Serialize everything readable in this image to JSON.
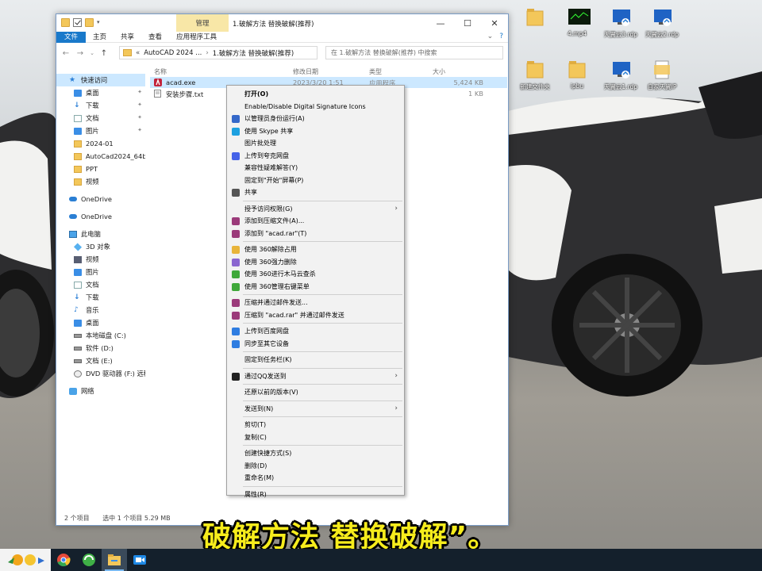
{
  "window": {
    "title": "1.破解方法 替换破解(推荐)",
    "manage_tab": "管理",
    "controls": [
      "—",
      "☐",
      "✕"
    ]
  },
  "ribbon": {
    "tabs": [
      "文件",
      "主页",
      "共享",
      "查看",
      "应用程序工具"
    ]
  },
  "address": {
    "path_root": "AutoCAD 2024 ...",
    "path_sep": "›",
    "path_leaf": "1.破解方法 替换破解(推荐)",
    "search_placeholder": "在 1.破解方法 替换破解(推荐) 中搜索"
  },
  "sidebar": {
    "items": [
      {
        "label": "快速访问",
        "icon": "star-icon",
        "pin": false,
        "sel": true,
        "indent": 0,
        "kind": "star"
      },
      {
        "label": "桌面",
        "icon": "desktop-icon",
        "pin": true,
        "indent": 1,
        "kind": "blue"
      },
      {
        "label": "下载",
        "icon": "download-icon",
        "pin": true,
        "indent": 1,
        "kind": "dl"
      },
      {
        "label": "文档",
        "icon": "document-icon",
        "pin": true,
        "indent": 1,
        "kind": "doc"
      },
      {
        "label": "图片",
        "icon": "picture-icon",
        "pin": true,
        "indent": 1,
        "kind": "blue"
      },
      {
        "label": "2024-01",
        "icon": "folder-icon",
        "pin": false,
        "indent": 1,
        "kind": "folder"
      },
      {
        "label": "AutoCad2024_64bi",
        "icon": "folder-icon",
        "pin": false,
        "indent": 1,
        "kind": "folder"
      },
      {
        "label": "PPT",
        "icon": "folder-icon",
        "pin": false,
        "indent": 1,
        "kind": "folder"
      },
      {
        "label": "视频",
        "icon": "folder-icon",
        "pin": false,
        "indent": 1,
        "kind": "folder"
      },
      {
        "label": "",
        "spacer": true
      },
      {
        "label": "OneDrive",
        "icon": "cloud-icon",
        "indent": 0,
        "kind": "cloud"
      },
      {
        "label": "",
        "spacer": true
      },
      {
        "label": "OneDrive",
        "icon": "cloud-icon",
        "indent": 0,
        "kind": "cloud"
      },
      {
        "label": "",
        "spacer": true
      },
      {
        "label": "此电脑",
        "icon": "computer-icon",
        "indent": 0,
        "kind": "pc"
      },
      {
        "label": "3D 对象",
        "icon": "3d-objects-icon",
        "indent": 1,
        "kind": "cube"
      },
      {
        "label": "视频",
        "icon": "video-icon",
        "indent": 1,
        "kind": "vid"
      },
      {
        "label": "图片",
        "icon": "picture-icon",
        "indent": 1,
        "kind": "blue"
      },
      {
        "label": "文档",
        "icon": "document-icon",
        "indent": 1,
        "kind": "doc"
      },
      {
        "label": "下载",
        "icon": "download-icon",
        "indent": 1,
        "kind": "dl"
      },
      {
        "label": "音乐",
        "icon": "music-icon",
        "indent": 1,
        "kind": "music"
      },
      {
        "label": "桌面",
        "icon": "desktop-icon",
        "indent": 1,
        "kind": "blue"
      },
      {
        "label": "本地磁盘 (C:)",
        "icon": "drive-icon",
        "indent": 1,
        "kind": "drive"
      },
      {
        "label": "软件 (D:)",
        "icon": "drive-icon",
        "indent": 1,
        "kind": "drive"
      },
      {
        "label": "文档 (E:)",
        "icon": "drive-icon",
        "indent": 1,
        "kind": "drive"
      },
      {
        "label": "DVD 驱动器 (F:) 远科",
        "icon": "dvd-icon",
        "indent": 1,
        "kind": "disc"
      },
      {
        "label": "",
        "spacer": true
      },
      {
        "label": "网络",
        "icon": "network-icon",
        "indent": 0,
        "kind": "net"
      }
    ]
  },
  "columns": {
    "name": "名称",
    "modified": "修改日期",
    "type": "类型",
    "size": "大小"
  },
  "files": [
    {
      "name": "acad.exe",
      "modified": "2023/3/20 1:51",
      "type": "应用程序",
      "size": "5,424 KB",
      "selected": true
    },
    {
      "name": "安装步骤.txt",
      "modified": "",
      "type": "",
      "size": "1 KB",
      "selected": false
    }
  ],
  "status": {
    "count": "2 个项目",
    "selected": "选中 1 个项目  5.29 MB"
  },
  "context_menu": [
    {
      "label": "打开(O)",
      "bold": true
    },
    {
      "label": "Enable/Disable Digital Signature Icons"
    },
    {
      "label": "以管理员身份运行(A)",
      "icon": "shield-icon",
      "color": "#3568c9"
    },
    {
      "label": "使用 Skype 共享",
      "icon": "skype-icon",
      "color": "#1da0e0"
    },
    {
      "label": "图片批处理"
    },
    {
      "label": "上传到夸克网盘",
      "icon": "quark-icon",
      "color": "#4563e8"
    },
    {
      "label": "兼容性疑难解答(Y)"
    },
    {
      "label": "固定到\"开始\"屏幕(P)"
    },
    {
      "label": "共享",
      "icon": "share-icon",
      "color": "#555555"
    },
    {
      "sep": true
    },
    {
      "label": "授予访问权限(G)",
      "arrow": true
    },
    {
      "label": "添加到压缩文件(A)...",
      "icon": "winrar-icon",
      "color": "#9b3a7a"
    },
    {
      "label": "添加到 \"acad.rar\"(T)",
      "icon": "winrar-icon",
      "color": "#9b3a7a"
    },
    {
      "sep": true
    },
    {
      "label": "使用 360解除占用",
      "icon": "360-unlock-icon",
      "color": "#e8b43a"
    },
    {
      "label": "使用 360强力删除",
      "icon": "360-delete-icon",
      "color": "#8a65d0"
    },
    {
      "label": "使用 360进行木马云查杀",
      "icon": "360-scan-icon",
      "color": "#3fa83a"
    },
    {
      "label": "使用 360管理右键菜单",
      "icon": "360-menu-icon",
      "color": "#3fa83a"
    },
    {
      "sep": true
    },
    {
      "label": "压缩并通过邮件发送...",
      "icon": "winrar-icon",
      "color": "#9b3a7a"
    },
    {
      "label": "压缩到 \"acad.rar\" 并通过邮件发送",
      "icon": "winrar-icon",
      "color": "#9b3a7a"
    },
    {
      "sep": true
    },
    {
      "label": "上传到百度网盘",
      "icon": "baidu-icon",
      "color": "#2f7de1"
    },
    {
      "label": "同步至其它设备",
      "icon": "baidu-icon",
      "color": "#2f7de1"
    },
    {
      "sep": true
    },
    {
      "label": "固定到任务栏(K)"
    },
    {
      "sep": true
    },
    {
      "label": "通过QQ发送到",
      "icon": "qq-icon",
      "color": "#222222",
      "arrow": true
    },
    {
      "sep": true
    },
    {
      "label": "还原以前的版本(V)"
    },
    {
      "sep": true
    },
    {
      "label": "发送到(N)",
      "arrow": true
    },
    {
      "sep": true
    },
    {
      "label": "剪切(T)"
    },
    {
      "label": "复制(C)"
    },
    {
      "sep": true
    },
    {
      "label": "创建快捷方式(S)"
    },
    {
      "label": "删除(D)"
    },
    {
      "label": "重命名(M)"
    },
    {
      "sep": true
    },
    {
      "label": "属性(R)"
    }
  ],
  "desktop": {
    "icons": [
      {
        "label": "",
        "kind": "folder"
      },
      {
        "label": "4.mp4",
        "kind": "video"
      },
      {
        "label": "天翼云3.rdp",
        "kind": "rdp"
      },
      {
        "label": "天翼云2.rdp",
        "kind": "rdp"
      },
      {
        "label": "新建文件夹",
        "kind": "folder"
      },
      {
        "label": "ipbu",
        "kind": "folder"
      },
      {
        "label": "天翼云1.rdp",
        "kind": "rdp"
      },
      {
        "label": "自家天翼IP",
        "kind": "doc"
      }
    ]
  },
  "caption": "破解方法 替换破解”。",
  "taskbar": {
    "items": [
      "start-icon",
      "chrome-icon",
      "360-browser-icon",
      "file-explorer-icon",
      "video-recorder-icon"
    ]
  }
}
